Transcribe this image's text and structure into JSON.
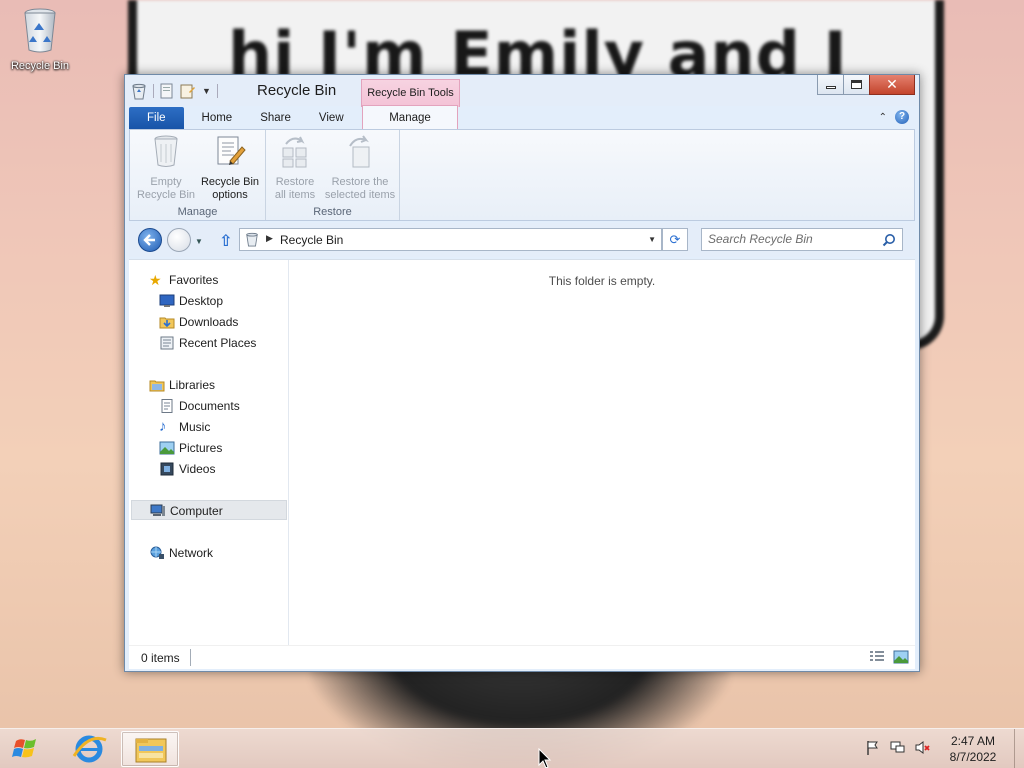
{
  "wallpaper": {
    "text": "hi I'm Emily and I"
  },
  "desktop": {
    "icons": [
      {
        "label": "Recycle Bin",
        "icon": "recycle-bin-icon"
      }
    ]
  },
  "window": {
    "title": "Recycle Bin",
    "context_tab_group": "Recycle Bin Tools",
    "ribbon_tabs": [
      "File",
      "Home",
      "Share",
      "View",
      "Manage"
    ],
    "ribbon": {
      "groups": [
        {
          "label": "Manage",
          "buttons": [
            {
              "line1": "Empty",
              "line2": "Recycle Bin",
              "enabled": false,
              "icon": "empty-recycle-bin-icon"
            },
            {
              "line1": "Recycle Bin",
              "line2": "options",
              "enabled": true,
              "icon": "recycle-bin-options-icon"
            }
          ]
        },
        {
          "label": "Restore",
          "buttons": [
            {
              "line1": "Restore",
              "line2": "all items",
              "enabled": false,
              "icon": "restore-all-icon"
            },
            {
              "line1": "Restore the",
              "line2": "selected items",
              "enabled": false,
              "icon": "restore-selected-icon"
            }
          ]
        }
      ]
    },
    "address": {
      "path": "Recycle Bin"
    },
    "search": {
      "placeholder": "Search Recycle Bin",
      "value": ""
    },
    "nav_pane": {
      "favorites": {
        "label": "Favorites",
        "items": [
          "Desktop",
          "Downloads",
          "Recent Places"
        ]
      },
      "libraries": {
        "label": "Libraries",
        "items": [
          "Documents",
          "Music",
          "Pictures",
          "Videos"
        ]
      },
      "computer": "Computer",
      "network": "Network"
    },
    "content": {
      "empty_message": "This folder is empty."
    },
    "status": {
      "items_text": "0 items"
    }
  },
  "taskbar": {
    "pinned": [
      "Internet Explorer",
      "File Explorer"
    ],
    "clock": {
      "time": "2:47 AM",
      "date": "8/7/2022"
    }
  },
  "colors": {
    "file_tab": "#1e5eb6",
    "context_tab": "#f5c8da",
    "close_button": "#c84a32",
    "accent": "#2a6fd1"
  }
}
